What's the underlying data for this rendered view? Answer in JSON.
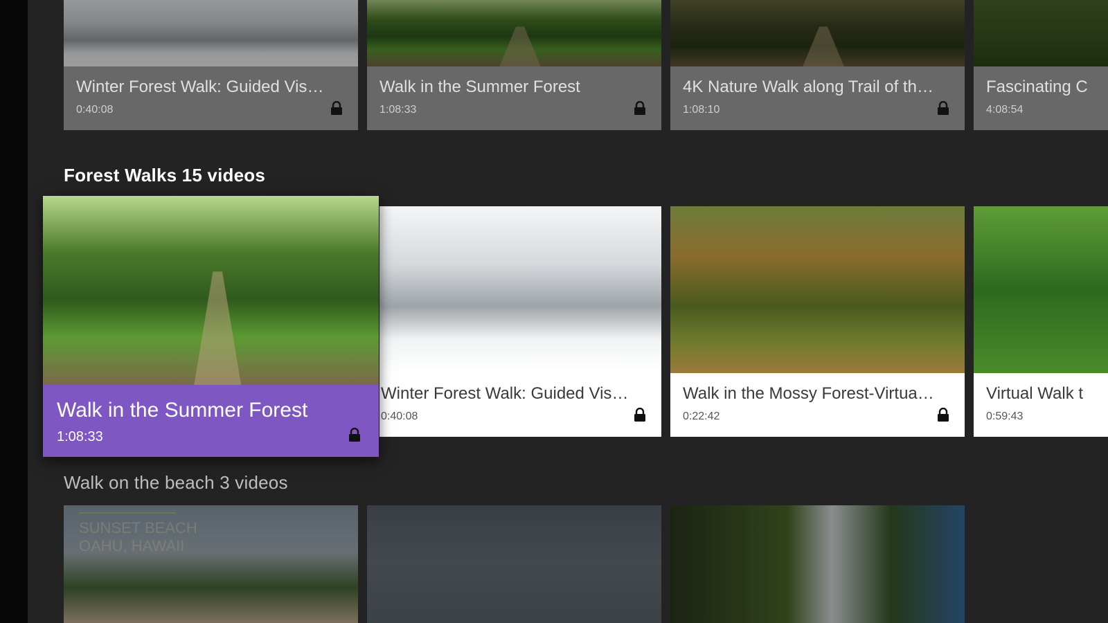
{
  "rows": [
    {
      "title": "",
      "cards": [
        {
          "title": "Winter Forest Walk: Guided Visual...",
          "duration": "0:40:08",
          "thumb": "snow-forest",
          "locked": true
        },
        {
          "title": "Walk in the Summer Forest",
          "duration": "1:08:33",
          "thumb": "summer-forest",
          "locked": true
        },
        {
          "title": "4K Nature Walk along Trail of the ...",
          "duration": "1:08:10",
          "thumb": "forest-trail",
          "locked": true
        },
        {
          "title": "Fascinating C",
          "duration": "4:08:54",
          "thumb": "green-forest",
          "locked": false
        }
      ]
    },
    {
      "title": "Forest Walks 15 videos",
      "cards": [
        {
          "title": "Walk in the Summer Forest",
          "duration": "1:08:33",
          "thumb": "summer-forest",
          "locked": true,
          "selected": true
        },
        {
          "title": "Winter Forest Walk: Guided Visual...",
          "duration": "0:40:08",
          "thumb": "snow-forest",
          "locked": true
        },
        {
          "title": "Walk in the Mossy Forest-Virtual ...",
          "duration": "0:22:42",
          "thumb": "mossy-forest",
          "locked": true
        },
        {
          "title": "Virtual Walk t",
          "duration": "0:59:43",
          "thumb": "jungle",
          "locked": false
        }
      ]
    },
    {
      "title": "Walk on the beach 3 videos",
      "cards": [
        {
          "thumb": "sunset-beach",
          "thumb_text": [
            "SUNSET BEACH",
            "OAHU, HAWAII"
          ]
        },
        {
          "thumb": "ocean-dock"
        },
        {
          "thumb": "waterfall"
        }
      ]
    }
  ],
  "colors": {
    "background": "#232323",
    "accent": "#7e57c2",
    "dim_info": "#686868"
  },
  "icons": {
    "lock": "lock-icon"
  }
}
